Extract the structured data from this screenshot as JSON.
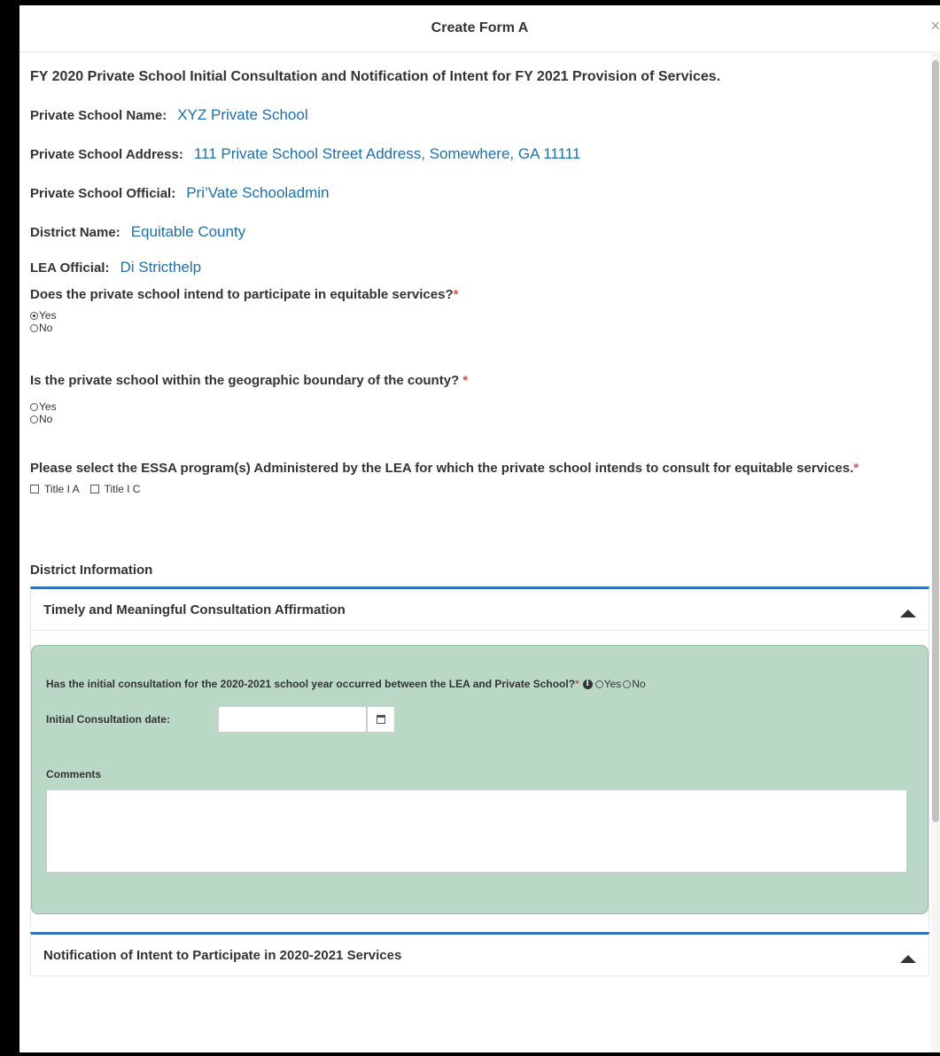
{
  "modal": {
    "title": "Create Form A",
    "close_glyph": "×"
  },
  "form": {
    "heading": "FY 2020 Private School Initial Consultation and Notification of Intent for FY 2021 Provision of Services.",
    "fields": [
      {
        "label": "Private School Name:",
        "value": "XYZ Private School"
      },
      {
        "label": "Private School Address:",
        "value": "111 Private School Street Address, Somewhere, GA 11111"
      },
      {
        "label": "Private School Official:",
        "value": "Pri’Vate Schooladmin"
      },
      {
        "label": "District Name:",
        "value": "Equitable County"
      },
      {
        "label": "LEA Official:",
        "value": "Di Stricthelp"
      }
    ],
    "q1": {
      "text": "Does the private school intend to participate in equitable services?",
      "required": "*",
      "options": [
        "Yes",
        "No"
      ],
      "selected": "Yes"
    },
    "q2": {
      "text": "Is the private school within the geographic boundary of the county?",
      "required": " *",
      "options": [
        "Yes",
        "No"
      ],
      "selected": ""
    },
    "q3": {
      "text": "Please select the ESSA program(s) Administered by the LEA for which the private school intends to consult for equitable services.",
      "required": "*",
      "options": [
        "Title I A",
        "Title I C"
      ]
    }
  },
  "district": {
    "section_title": "District Information",
    "panel1": {
      "title": "Timely and Meaningful Consultation Affirmation",
      "question": "Has the initial consultation for the 2020-2021 school year occurred between the LEA and Private School?",
      "required": "*",
      "info_icon": "i",
      "options": [
        "Yes",
        "No"
      ],
      "date_label": "Initial Consultation date:",
      "date_value": "",
      "comments_label": "Comments",
      "comments_value": ""
    },
    "panel2": {
      "title": "Notification of Intent to Participate in 2020-2021 Services"
    }
  },
  "colors": {
    "accent": "#2e73b8",
    "link": "#1f6fa8",
    "green_box": "#b9d9c6",
    "required": "#d9534f"
  }
}
